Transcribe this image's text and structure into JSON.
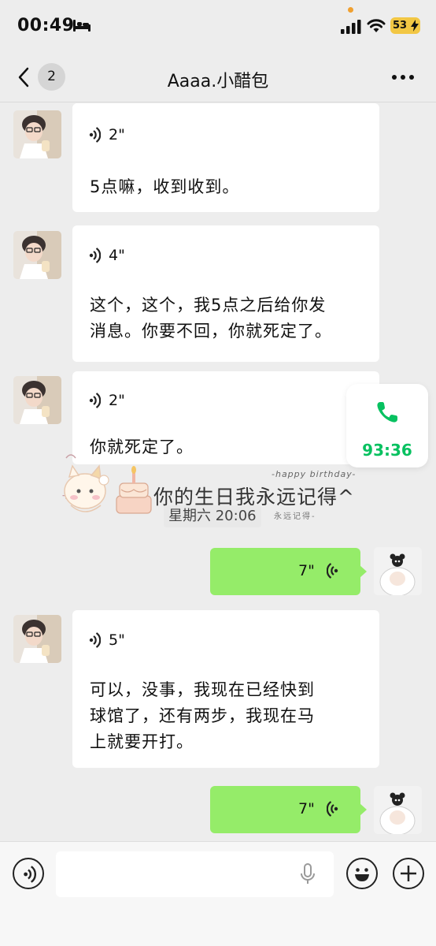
{
  "status_bar": {
    "time": "00:49",
    "battery": "53"
  },
  "nav": {
    "unread_count": "2",
    "title": "Aaaa.小醋包"
  },
  "messages": [
    {
      "side": "left",
      "duration": "2\"",
      "transcript": "5点嘛，收到收到。"
    },
    {
      "side": "left",
      "duration": "4\"",
      "transcript_lines": [
        "这个，这个，我5点之后给你发",
        "消息。你要不回，你就死定了。"
      ]
    },
    {
      "side": "left",
      "duration": "2\"",
      "transcript": "你就死定了。"
    },
    {
      "side": "right",
      "duration": "7\""
    },
    {
      "side": "left",
      "duration": "5\"",
      "transcript_lines": [
        "可以，没事，我现在已经快到",
        "球馆了，还有两步，我现在马",
        "上就要开打。"
      ]
    },
    {
      "side": "right",
      "duration": "7\""
    }
  ],
  "time_label": "星期六 20:06",
  "sticker": {
    "main_text": "你的生日我永远记得^",
    "top_text": "-happy birthday-",
    "bottom_text": "永远记得-"
  },
  "call_widget": {
    "duration": "93:36"
  },
  "input": {
    "value": ""
  }
}
